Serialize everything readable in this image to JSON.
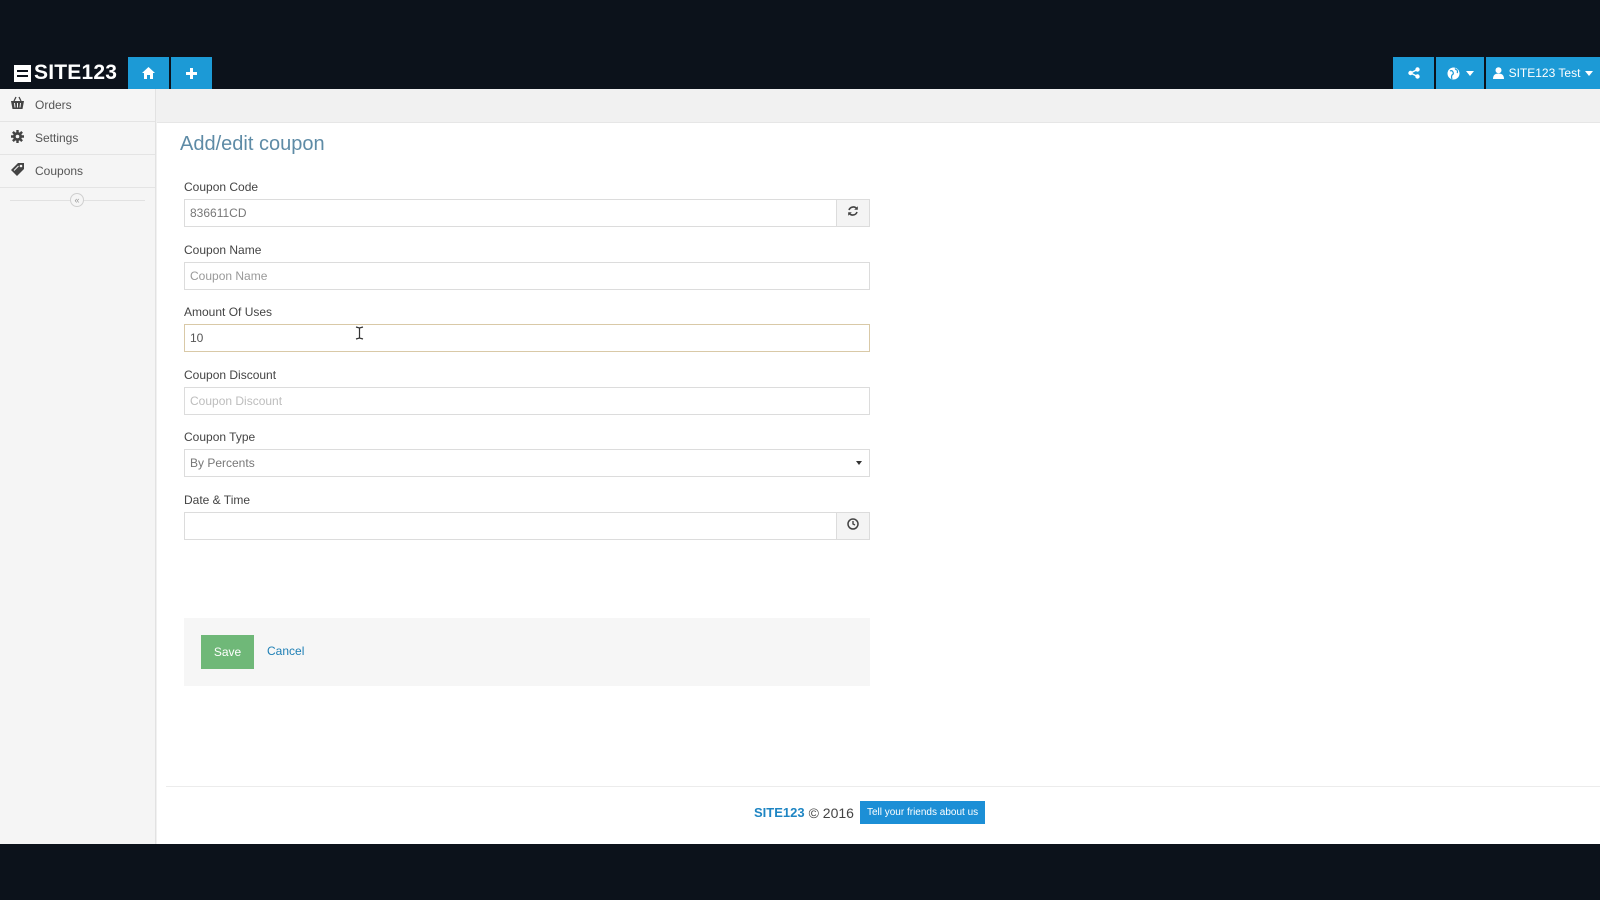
{
  "header": {
    "logo_text": "SITE123",
    "user_label": "SITE123 Test",
    "icons": [
      "home-icon",
      "plus-icon",
      "share-icon",
      "globe-icon",
      "user-icon"
    ]
  },
  "sidebar": {
    "items": [
      {
        "label": "Orders",
        "icon": "basket-icon"
      },
      {
        "label": "Settings",
        "icon": "gear-icon"
      },
      {
        "label": "Coupons",
        "icon": "tag-icon"
      }
    ],
    "collapse_glyph": "«"
  },
  "page": {
    "title": "Add/edit coupon"
  },
  "form": {
    "coupon_code": {
      "label": "Coupon Code",
      "value": "836611CD"
    },
    "coupon_name": {
      "label": "Coupon Name",
      "value": "",
      "placeholder": "Coupon Name"
    },
    "amount_of_uses": {
      "label": "Amount Of Uses",
      "value": "10"
    },
    "coupon_discount": {
      "label": "Coupon Discount",
      "value": "",
      "placeholder": "Coupon Discount"
    },
    "coupon_type": {
      "label": "Coupon Type",
      "selected": "By Percents"
    },
    "date_time": {
      "label": "Date & Time",
      "value": ""
    },
    "save_label": "Save",
    "cancel_label": "Cancel"
  },
  "footer": {
    "brand": "SITE123",
    "copyright": "© 2016",
    "tell_button": "Tell your friends about us"
  },
  "colors": {
    "accent": "#1c9ad6",
    "title": "#5e8ba6",
    "save": "#6fb878"
  }
}
